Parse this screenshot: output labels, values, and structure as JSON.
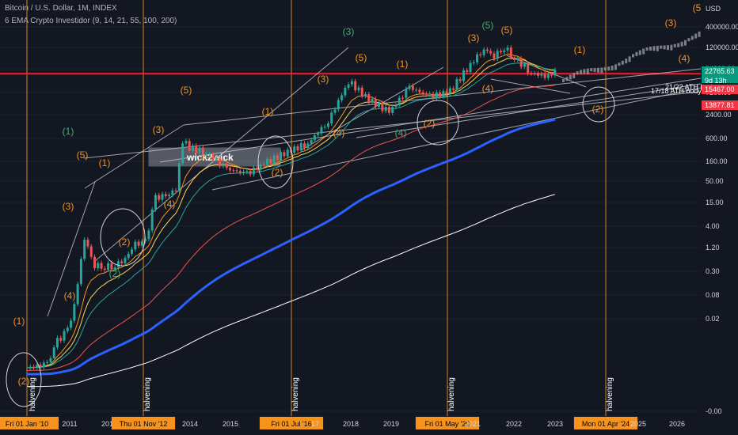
{
  "header": {
    "symbol_line": "Bitcoin / U.S. Dollar, 1M, INDEX",
    "indicator_line": "6 EMA Crypto Investidor (9, 14, 21, 55, 100, 200)"
  },
  "currency": "USD",
  "colors": {
    "background": "#131722",
    "orange": "#f7931a",
    "green_label": "#3cb371",
    "candle_up": "#26a69a",
    "candle_down": "#ef5350",
    "blue_ema": "#2962ff",
    "red_line": "#f23645",
    "price_up_badge": "#26a69a",
    "price_down_badge": "#f23645"
  },
  "price_badges": [
    {
      "value": "22765.63",
      "color": "#089981"
    },
    {
      "value": "9d 13h",
      "color": "#089981"
    },
    {
      "value": "15467.00",
      "color": "#f23645"
    },
    {
      "value": "13877.81",
      "color": "#f23645"
    }
  ],
  "annotations": {
    "box_label": "wick2wick",
    "ath_label": "17/18 ATH body",
    "ath_label_overlap": "21/22 ATH body",
    "halvening_label": "halvening"
  },
  "chart_data": {
    "type": "candlestick",
    "title": "Bitcoin / U.S. Dollar, 1M, INDEX",
    "y_scale": "log",
    "y_ticks": [
      "400000.00",
      "120000.00",
      "24000.00",
      "7200.00",
      "2400.00",
      "600.00",
      "160.00",
      "50.00",
      "15.00",
      "4.00",
      "1.20",
      "0.30",
      "0.08",
      "0.02",
      "-0.00"
    ],
    "x_ticks": [
      "Fri 01 Jan '10",
      "2011",
      "2012",
      "Thu 01 Nov '12",
      "2014",
      "2015",
      "20",
      "Fri 01 Jul '16",
      "17",
      "2018",
      "2019",
      "Fri 01 May '20",
      "2021",
      "2022",
      "2023",
      "Mon 01 Apr '24",
      "2025",
      "2026"
    ],
    "x_tick_highlighted": [
      "Fri 01 Jan '10",
      "Thu 01 Nov '12",
      "Fri 01 Jul '16",
      "Fri 01 May '20",
      "Mon 01 Apr '24"
    ],
    "halvings": [
      "2010-01",
      "2012-11",
      "2016-07",
      "2020-05",
      "2024-04"
    ],
    "horizontal_line_price": 19800,
    "ohlc_monthly": [
      {
        "t": "2010-01",
        "c": 0.06
      },
      {
        "t": "2010-07",
        "c": 0.07
      },
      {
        "t": "2010-10",
        "c": 0.19
      },
      {
        "t": "2011-01",
        "c": 0.3
      },
      {
        "t": "2011-03",
        "c": 0.9
      },
      {
        "t": "2011-06",
        "c": 16
      },
      {
        "t": "2011-09",
        "c": 5
      },
      {
        "t": "2011-12",
        "c": 4.7
      },
      {
        "t": "2012-03",
        "c": 4.9
      },
      {
        "t": "2012-06",
        "c": 6.7
      },
      {
        "t": "2012-09",
        "c": 12.4
      },
      {
        "t": "2012-12",
        "c": 13.5
      },
      {
        "t": "2013-03",
        "c": 93
      },
      {
        "t": "2013-06",
        "c": 97
      },
      {
        "t": "2013-09",
        "c": 133
      },
      {
        "t": "2013-11",
        "c": 1100
      },
      {
        "t": "2014-01",
        "c": 800
      },
      {
        "t": "2014-06",
        "c": 640
      },
      {
        "t": "2014-12",
        "c": 320
      },
      {
        "t": "2015-06",
        "c": 260
      },
      {
        "t": "2015-12",
        "c": 430
      },
      {
        "t": "2016-06",
        "c": 670
      },
      {
        "t": "2016-12",
        "c": 960
      },
      {
        "t": "2017-06",
        "c": 2500
      },
      {
        "t": "2017-12",
        "c": 14000
      },
      {
        "t": "2018-06",
        "c": 6400
      },
      {
        "t": "2018-12",
        "c": 3700
      },
      {
        "t": "2019-06",
        "c": 10800
      },
      {
        "t": "2019-12",
        "c": 7200
      },
      {
        "t": "2020-06",
        "c": 9100
      },
      {
        "t": "2020-12",
        "c": 29000
      },
      {
        "t": "2021-04",
        "c": 57000
      },
      {
        "t": "2021-07",
        "c": 41500
      },
      {
        "t": "2021-10",
        "c": 61000
      },
      {
        "t": "2022-01",
        "c": 38500
      },
      {
        "t": "2022-06",
        "c": 19800
      },
      {
        "t": "2022-12",
        "c": 16500
      },
      {
        "t": "2023-01",
        "c": 22765.63
      }
    ],
    "wave_labels": [
      {
        "text": "(2)",
        "color": "orange"
      },
      {
        "text": "(1)",
        "color": "orange"
      },
      {
        "text": "(4)",
        "color": "orange"
      },
      {
        "text": "(3)",
        "color": "orange"
      },
      {
        "text": "(5)",
        "color": "orange"
      },
      {
        "text": "(1)",
        "color": "green"
      },
      {
        "text": "(1)",
        "color": "orange"
      },
      {
        "text": "(2)",
        "color": "orange"
      },
      {
        "text": "(2)",
        "color": "green"
      },
      {
        "text": "(3)",
        "color": "orange"
      },
      {
        "text": "(4)",
        "color": "orange"
      },
      {
        "text": "(5)",
        "color": "orange"
      },
      {
        "text": "(1)",
        "color": "orange"
      },
      {
        "text": "(2)",
        "color": "orange"
      },
      {
        "text": "(3)",
        "color": "orange"
      },
      {
        "text": "(4)",
        "color": "orange"
      },
      {
        "text": "(3)",
        "color": "green"
      },
      {
        "text": "(5)",
        "color": "orange"
      },
      {
        "text": "(4)",
        "color": "green"
      },
      {
        "text": "(1)",
        "color": "orange"
      },
      {
        "text": "(2)",
        "color": "orange"
      },
      {
        "text": "(3)",
        "color": "orange"
      },
      {
        "text": "(5)",
        "color": "green"
      },
      {
        "text": "(5)",
        "color": "orange"
      },
      {
        "text": "(4)",
        "color": "orange"
      },
      {
        "text": "(1)",
        "color": "orange"
      },
      {
        "text": "(2)",
        "color": "orange"
      },
      {
        "text": "(3)",
        "color": "orange"
      },
      {
        "text": "(4)",
        "color": "orange"
      },
      {
        "text": "(5",
        "color": "orange"
      }
    ]
  }
}
